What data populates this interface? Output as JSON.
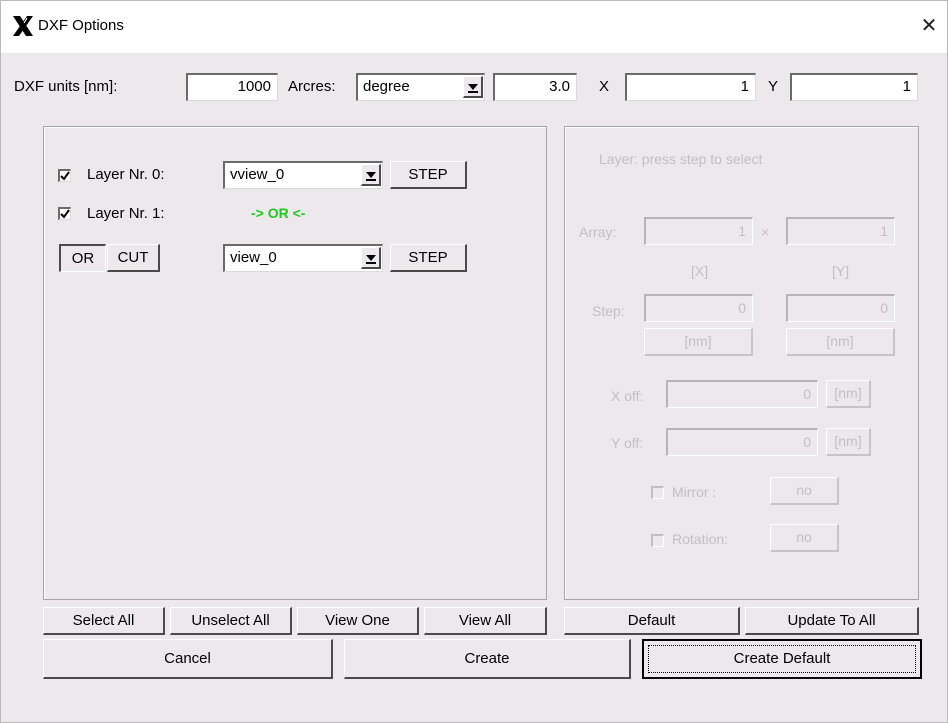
{
  "window": {
    "title": "DXF Options",
    "close": "✕"
  },
  "top": {
    "units_label": "DXF units [nm]:",
    "units_value": "1000",
    "arcres_label": "Arcres:",
    "arcres_mode": "degree",
    "arcres_value": "3.0",
    "x_label": "X",
    "x_value": "1",
    "y_label": "Y",
    "y_value": "1"
  },
  "layers": {
    "layer0": {
      "label": "Layer Nr. 0:",
      "checked": true,
      "view": "vview_0",
      "step": "STEP"
    },
    "layer1": {
      "label": "Layer Nr. 1:",
      "checked": true,
      "op_text": "-> OR <-"
    },
    "op_or": "OR",
    "op_cut": "CUT",
    "layer1_view": "view_0",
    "layer1_step": "STEP"
  },
  "left_buttons": {
    "select_all": "Select All",
    "unselect_all": "Unselect All",
    "view_one": "View One",
    "view_all": "View All"
  },
  "right_panel": {
    "hint": "Layer: press step to select",
    "array_label": "Array:",
    "array_x": "1",
    "times": "×",
    "array_y": "1",
    "x_unit": "[X]",
    "y_unit": "[Y]",
    "step_label": "Step:",
    "step_x": "0",
    "step_y": "0",
    "nm_btn": "[nm]",
    "xoff_label": "X off:",
    "xoff_value": "0",
    "yoff_label": "Y off:",
    "yoff_value": "0",
    "mirror_label": "Mirror   :",
    "mirror_value": "no",
    "rotation_label": "Rotation:",
    "rotation_value": "no"
  },
  "right_buttons": {
    "default": "Default",
    "update_all": "Update To All"
  },
  "bottom_buttons": {
    "cancel": "Cancel",
    "create": "Create",
    "create_default": "Create Default"
  }
}
